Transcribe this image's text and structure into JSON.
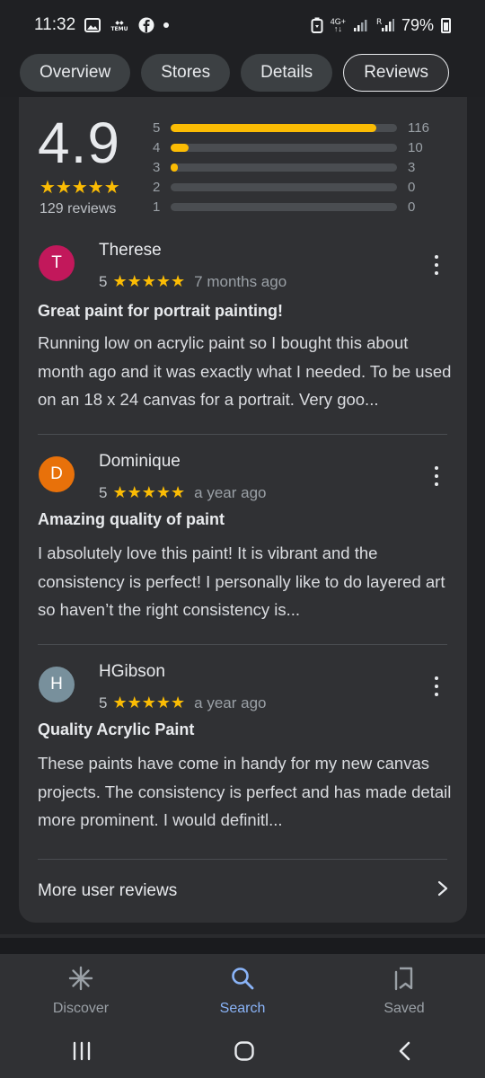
{
  "status_bar": {
    "time": "11:32",
    "notification_icons": [
      "image-icon",
      "temu-icon",
      "facebook-icon"
    ],
    "network": "4G+",
    "battery": "79%"
  },
  "tabs": [
    {
      "label": "Overview",
      "active": false
    },
    {
      "label": "Stores",
      "active": false
    },
    {
      "label": "Details",
      "active": false
    },
    {
      "label": "Reviews",
      "active": true
    }
  ],
  "summary": {
    "rating": "4.9",
    "stars": "★★★★★",
    "review_count": "129 reviews",
    "histogram": [
      {
        "label": "5",
        "count": "116",
        "fraction": 0.91
      },
      {
        "label": "4",
        "count": "10",
        "fraction": 0.08
      },
      {
        "label": "3",
        "count": "3",
        "fraction": 0.03
      },
      {
        "label": "2",
        "count": "0",
        "fraction": 0
      },
      {
        "label": "1",
        "count": "0",
        "fraction": 0
      }
    ]
  },
  "reviews": [
    {
      "initial": "T",
      "avatar_color": "#c2185b",
      "author": "Therese",
      "rating": "5",
      "stars": "★★★★★",
      "ago": "7 months ago",
      "title": "Great paint for portrait painting!",
      "body": "Running low on acrylic paint so I bought this about month ago and it was exactly what I needed. To be used on an 18 x 24 canvas for a portrait. Very goo..."
    },
    {
      "initial": "D",
      "avatar_color": "#e8710a",
      "author": "Dominique",
      "rating": "5",
      "stars": "★★★★★",
      "ago": "a year ago",
      "title": "Amazing quality of paint",
      "body": "I absolutely love this paint! It is vibrant and the consistency is perfect! I personally like to do layered art so haven’t the right consistency is..."
    },
    {
      "initial": "H",
      "avatar_color": "#78909c",
      "author": "HGibson",
      "rating": "5",
      "stars": "★★★★★",
      "ago": "a year ago",
      "title": "Quality Acrylic Paint",
      "body": "These paints have come in handy for my new canvas projects. The consistency is perfect and has made detail more prominent. I would definitl..."
    }
  ],
  "more_reviews": {
    "label": "More user reviews"
  },
  "bottom_nav": [
    {
      "label": "Discover",
      "icon": "discover-icon",
      "active": false
    },
    {
      "label": "Search",
      "icon": "search-icon",
      "active": true
    },
    {
      "label": "Saved",
      "icon": "bookmarks-icon",
      "active": false
    }
  ],
  "colors": {
    "accent_blue": "#8ab4f8",
    "star_yellow": "#fbbc04",
    "card_bg": "#303134",
    "page_bg": "#202124"
  }
}
